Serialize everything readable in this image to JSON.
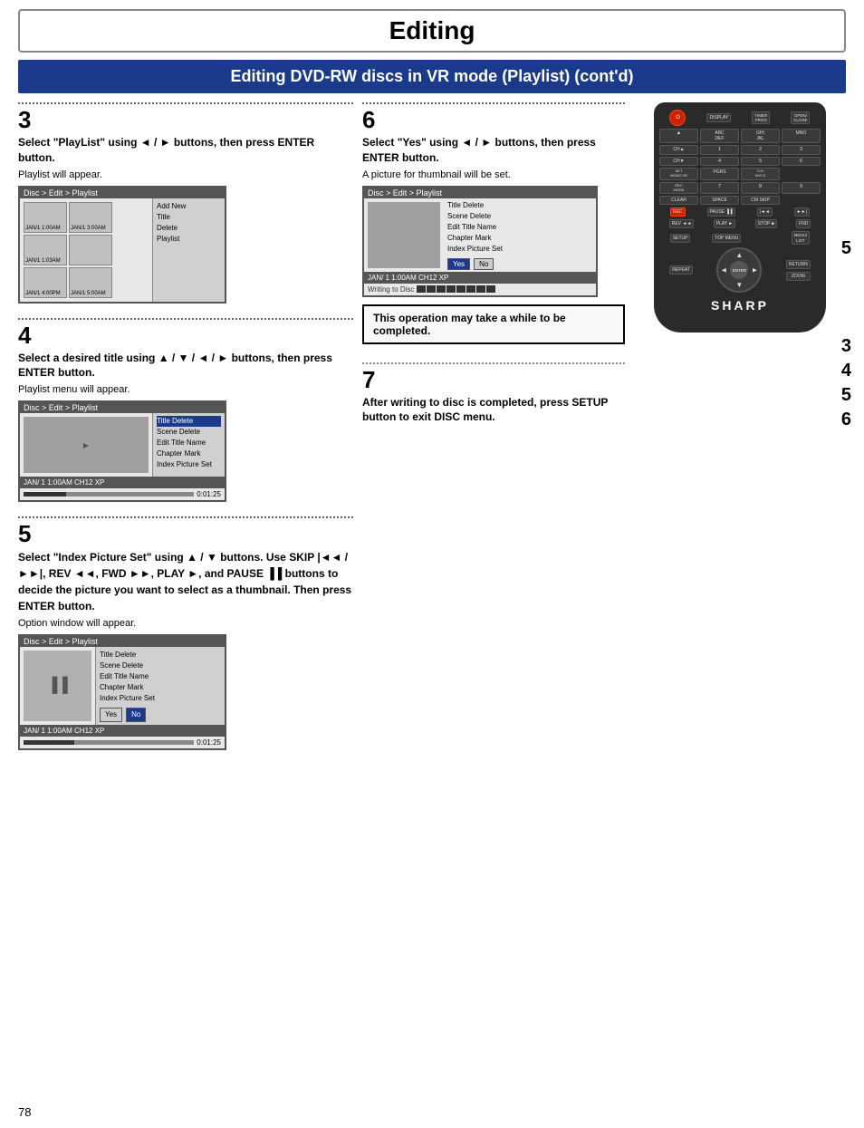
{
  "page": {
    "title": "Editing",
    "section_header": "Editing DVD-RW discs in VR mode (Playlist) (cont'd)",
    "page_number": "78"
  },
  "step3": {
    "number": "3",
    "heading": "Select \"PlayList\" using ◄ / ► buttons, then press ENTER button.",
    "subtext": "Playlist will appear.",
    "screen": {
      "title": "Disc > Edit > Playlist",
      "thumbnails": [
        {
          "label": "JAN/1  1:00AM"
        },
        {
          "label": "JAN/1  3:00AM"
        },
        {
          "label": "JAN/1  1:03AM"
        },
        {
          "label": ""
        },
        {
          "label": "JAN/1  4:00PM"
        },
        {
          "label": "JAN/1  5:00AM"
        }
      ],
      "menu_items": [
        "Add New Title",
        "Delete Playlist"
      ]
    }
  },
  "step4": {
    "number": "4",
    "heading": "Select a desired title using ▲ / ▼ / ◄ / ► buttons, then press ENTER button.",
    "subtext": "Playlist menu will appear.",
    "screen": {
      "title": "Disc > Edit > Playlist",
      "footer_text": "JAN/ 1  1:00AM CH12   XP",
      "time": "0:01:25",
      "menu_items": [
        {
          "text": "Title Delete",
          "selected": true
        },
        {
          "text": "Scene Delete",
          "selected": false
        },
        {
          "text": "Edit Title Name",
          "selected": false
        },
        {
          "text": "Chapter Mark",
          "selected": false
        },
        {
          "text": "Index Picture Set",
          "selected": false
        }
      ]
    }
  },
  "step5": {
    "number": "5",
    "heading_parts": {
      "line1": "Select \"Index Picture Set\"",
      "line2": "using ▲ / ▼ buttons. Use SKIP",
      "line3": "|◄◄ / ►►|, REV ◄◄, FWD ►►,",
      "line4": "PLAY ►, and PAUSE ▐▐ but-",
      "line5": "tons to decide the picture",
      "line6": "you want to select as a",
      "line7": "thumbnail. Then press ENTER",
      "line8": "button."
    },
    "subtext": "Option window will appear.",
    "screen": {
      "title": "Disc > Edit > Playlist",
      "footer_text": "JAN/ 1  1:00AM CH12   XP",
      "time": "0:01:25",
      "pause_symbol": "II",
      "menu_items": [
        {
          "text": "Title Delete",
          "selected": false
        },
        {
          "text": "Scene Delete",
          "selected": false
        },
        {
          "text": "Edit Title Name",
          "selected": false
        },
        {
          "text": "Chapter Mark",
          "selected": false
        },
        {
          "text": "Index Picture Set",
          "selected": false
        }
      ],
      "dialog": {
        "yes_label": "Yes",
        "no_label": "No",
        "no_active": true
      }
    }
  },
  "step6": {
    "number": "6",
    "heading": "Select \"Yes\" using ◄ / ► buttons, then press ENTER button.",
    "subtext": "A picture for thumbnail will be set.",
    "screen": {
      "title": "Disc > Edit > Playlist",
      "footer_text": "JAN/ 1  1:00AM CH12   XP",
      "writing_text": "Writing to Disc",
      "menu_items": [
        {
          "text": "Title Delete",
          "selected": false
        },
        {
          "text": "Scene Delete",
          "selected": false
        },
        {
          "text": "Edit Title Name",
          "selected": false
        },
        {
          "text": "Chapter Mark",
          "selected": false
        },
        {
          "text": "Index Picture Set",
          "selected": false
        }
      ],
      "dialog": {
        "yes_label": "Yes",
        "no_label": "No",
        "yes_active": true
      }
    },
    "notice": "This operation may take a while to be completed."
  },
  "step7": {
    "number": "7",
    "heading": "After writing to disc is completed, press SETUP button to exit DISC menu."
  },
  "remote": {
    "buttons": {
      "power": "POWER",
      "display": "DISPLAY",
      "timer_prog": "TIMER PROG",
      "open_close": "OPEN/CLOSE",
      "row1": [
        "▲",
        "ABC DEF",
        "GHI JKL",
        "MNO"
      ],
      "row2": [
        "CH▲",
        "1",
        "2",
        "3"
      ],
      "row3": [
        "CH▼",
        "4",
        "5",
        "6"
      ],
      "row4": [
        "SET MONITOR",
        "PGRS",
        "TUV WXYZ",
        ""
      ],
      "row5": [
        "7",
        "8",
        "9",
        ""
      ],
      "rec_mode": "REC MODE",
      "clear": "CLEAR",
      "space": "SPACE",
      "cm_skip": "CM SKIP",
      "rec": "REC",
      "pause": "PAUSE",
      "skip_back": "|◄◄",
      "skip_fwd": "►►|",
      "rev": "REV ◄◄",
      "play": "PLAY ►",
      "fwd": "FWD ►►",
      "stop": "STOP ■",
      "find": "FND",
      "setup": "SETUP",
      "top_menu": "TOP MENU",
      "menu_list": "MENU/LIST",
      "repeat": "REPEAT",
      "zoom": "ZOOM",
      "enter": "ENTER",
      "return": "RETURN",
      "nav": {
        "up": "▲",
        "down": "▼",
        "left": "◄",
        "right": "►"
      }
    },
    "step_labels": [
      "5",
      "3",
      "4",
      "5",
      "6"
    ]
  }
}
